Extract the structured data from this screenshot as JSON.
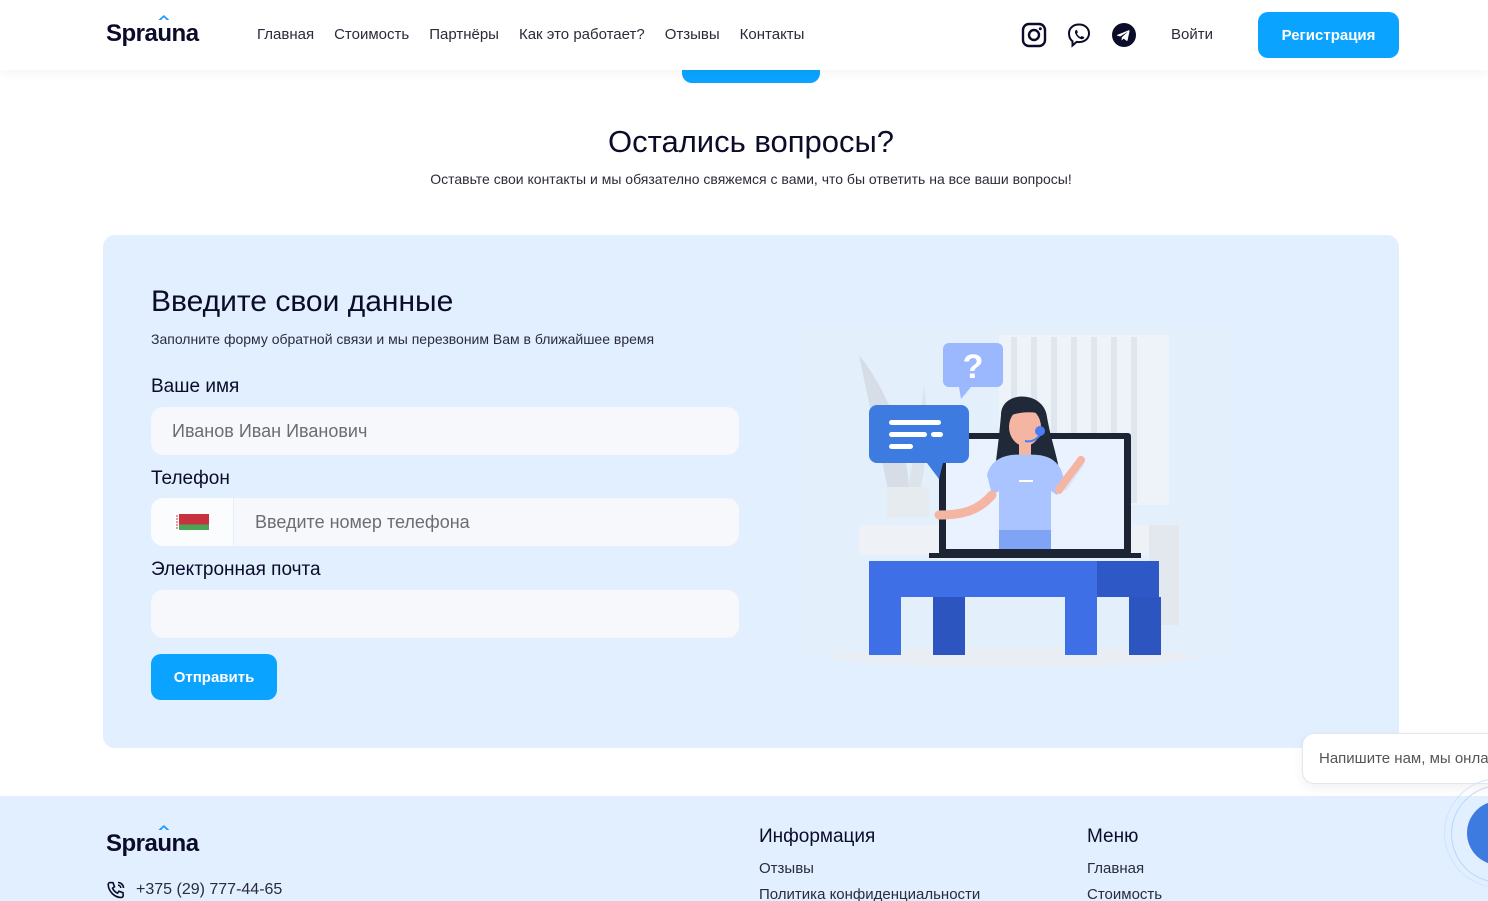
{
  "header": {
    "logo": {
      "prefix": "Spra",
      "mark": "u",
      "suffix": "na"
    },
    "nav": [
      "Главная",
      "Стоимость",
      "Партнёры",
      "Как это работает?",
      "Отзывы",
      "Контакты"
    ],
    "socials": [
      "instagram-icon",
      "viber-icon",
      "telegram-icon"
    ],
    "login_label": "Войти",
    "register_label": "Регистрация"
  },
  "questions": {
    "title": "Остались вопросы?",
    "subtitle": "Оставьте свои контакты и мы обязателно свяжемся с вами, что бы ответить на все ваши вопросы!"
  },
  "form": {
    "title": "Введите свои данные",
    "subtitle": "Заполните форму обратной связи и мы перезвоним Вам в ближайшее время",
    "name_label": "Ваше имя",
    "name_placeholder": "Иванов Иван Иванович",
    "phone_label": "Телефон",
    "phone_placeholder": "Введите номер телефона",
    "email_label": "Электронная почта",
    "email_placeholder": "",
    "submit_label": "Отправить",
    "colors": {
      "accent": "#0aa3ff",
      "panel": "#e1efff"
    }
  },
  "chat": {
    "placeholder": "Напишите нам, мы онлайн!"
  },
  "footer": {
    "logo": {
      "prefix": "Spra",
      "mark": "u",
      "suffix": "na"
    },
    "phone": "+375 (29) 777-44-65",
    "info": {
      "title": "Информация",
      "links": [
        "Отзывы",
        "Политика конфиденциальности"
      ]
    },
    "menu": {
      "title": "Меню",
      "links": [
        "Главная",
        "Стоимость"
      ]
    }
  }
}
